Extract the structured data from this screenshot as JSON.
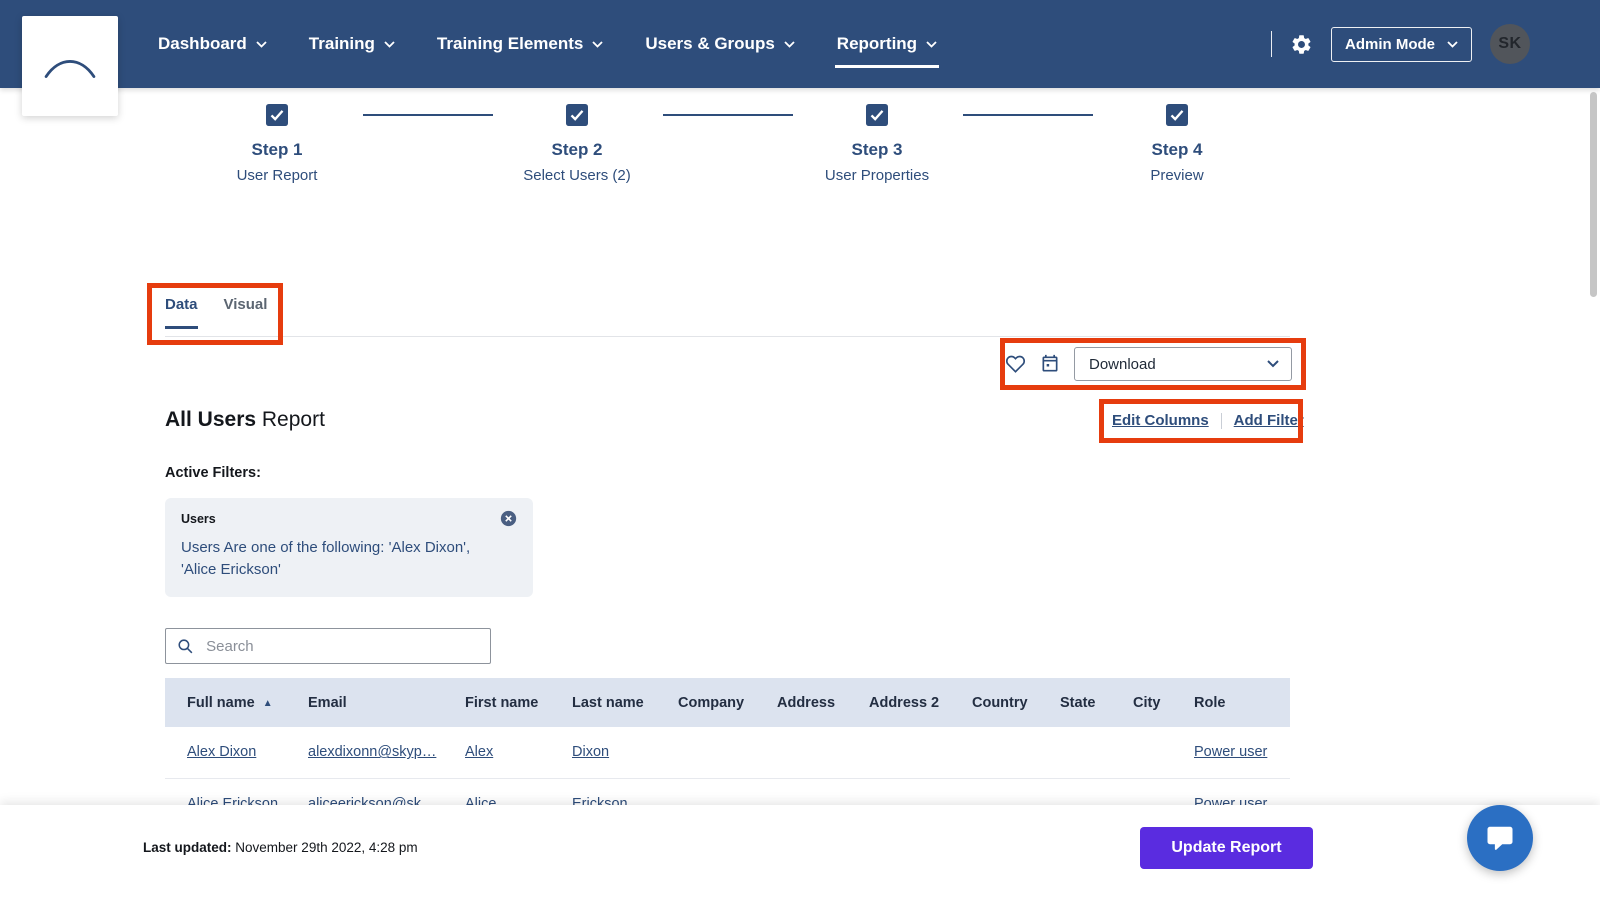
{
  "nav": {
    "items": [
      {
        "label": "Dashboard"
      },
      {
        "label": "Training"
      },
      {
        "label": "Training Elements"
      },
      {
        "label": "Users & Groups"
      },
      {
        "label": "Reporting"
      }
    ],
    "admin_mode_label": "Admin Mode",
    "avatar_initials": "SK"
  },
  "stepper": {
    "steps": [
      {
        "title": "Step 1",
        "subtitle": "User Report"
      },
      {
        "title": "Step 2",
        "subtitle": "Select Users (2)"
      },
      {
        "title": "Step 3",
        "subtitle": "User Properties"
      },
      {
        "title": "Step 4",
        "subtitle": "Preview"
      }
    ]
  },
  "tabs": {
    "data": "Data",
    "visual": "Visual"
  },
  "toolbar": {
    "download": "Download"
  },
  "report": {
    "title_bold": "All Users",
    "title_rest": "Report",
    "edit_columns": "Edit Columns",
    "add_filter": "Add Filter",
    "active_filters": "Active Filters:"
  },
  "filter": {
    "name": "Users",
    "description": "Users Are one of the following: 'Alex Dixon', 'Alice Erickson'"
  },
  "search": {
    "placeholder": "Search"
  },
  "table": {
    "sort_indicator": "▲",
    "columns": [
      "Full name",
      "Email",
      "First name",
      "Last name",
      "Company",
      "Address",
      "Address 2",
      "Country",
      "State",
      "City",
      "Role"
    ],
    "rows": [
      {
        "cells": [
          "Alex Dixon",
          "alexdixonn@skyp…",
          "Alex",
          "Dixon",
          "",
          "",
          "",
          "",
          "",
          "",
          "Power user"
        ]
      },
      {
        "cells": [
          "Alice Erickson",
          "aliceerickson@sk…",
          "Alice",
          "Erickson",
          "",
          "",
          "",
          "",
          "",
          "",
          "Power user"
        ]
      }
    ]
  },
  "footer": {
    "last_updated_label": "Last updated:",
    "last_updated_value": "November 29th 2022, 4:28 pm",
    "update_button": "Update Report"
  },
  "colors": {
    "nav_bg": "#2e4d7b",
    "accent_blue": "#2e4d7b",
    "annotation_red": "#e63c0e",
    "button_purple": "#5a2ce0",
    "chat_blue": "#2b6fc3",
    "table_header_bg": "#dce3ef"
  }
}
